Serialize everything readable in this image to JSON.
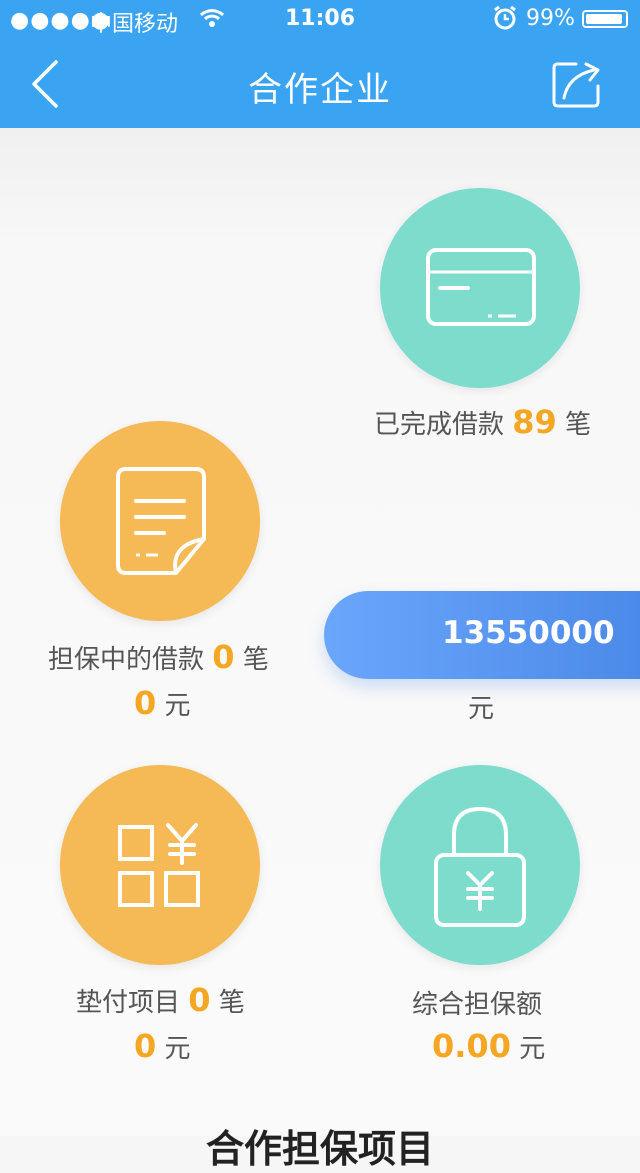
{
  "status_bar": {
    "signal_dots": "●●●●●",
    "carrier": "中国移动",
    "time": "11:06",
    "battery": "99%"
  },
  "nav": {
    "title": "合作企业"
  },
  "stats": {
    "completed": {
      "prefix": "已完成借款",
      "count": "89",
      "unit": "笔"
    },
    "guaranteeing": {
      "prefix": "担保中的借款",
      "count": "0",
      "unit": "笔",
      "amount": "0",
      "amount_unit": "元"
    },
    "total_amount": {
      "value": "13550000",
      "unit": "元"
    },
    "advance": {
      "prefix": "垫付项目",
      "count": "0",
      "unit": "笔",
      "amount": "0",
      "amount_unit": "元"
    },
    "guarantee_total": {
      "label": "综合担保额",
      "amount": "0.00",
      "amount_unit": "元"
    }
  },
  "section_title": "合作担保项目",
  "colors": {
    "nav": "#3aa3f2",
    "teal": "#7edccc",
    "orange": "#f5b955",
    "accent": "#f5a623",
    "pill": "#5a97f0"
  }
}
